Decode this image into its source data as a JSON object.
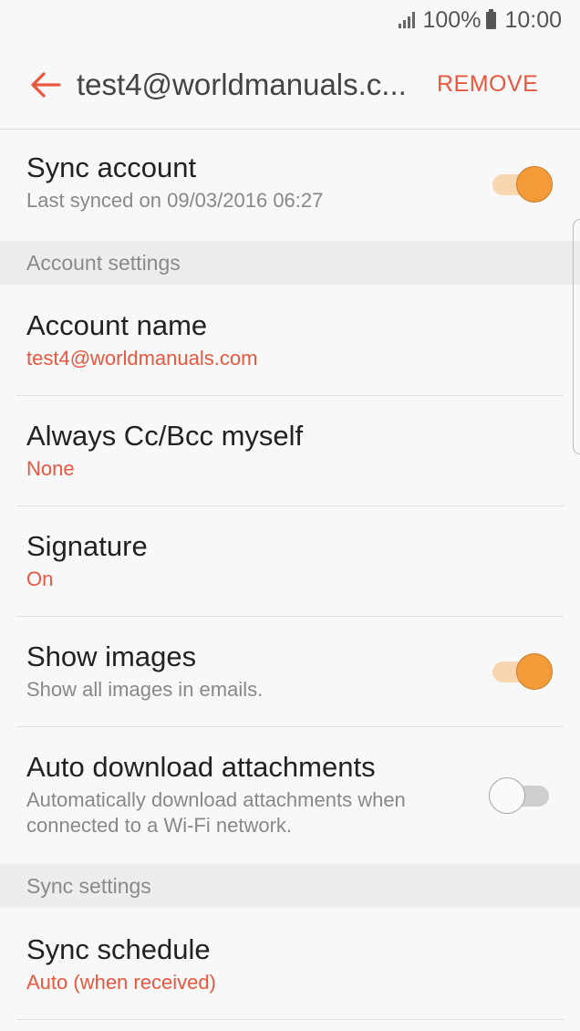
{
  "status_bar": {
    "battery": "100%",
    "time": "10:00"
  },
  "app_bar": {
    "title": "test4@worldmanuals.c...",
    "action": "REMOVE"
  },
  "rows": {
    "sync_account": {
      "title": "Sync account",
      "subtitle": "Last synced on 09/03/2016 06:27",
      "toggle": "on"
    },
    "account_name": {
      "title": "Account name",
      "value": "test4@worldmanuals.com"
    },
    "cc_bcc": {
      "title": "Always Cc/Bcc myself",
      "value": "None"
    },
    "signature": {
      "title": "Signature",
      "value": "On"
    },
    "show_images": {
      "title": "Show images",
      "subtitle": "Show all images in emails.",
      "toggle": "on"
    },
    "auto_download": {
      "title": "Auto download attachments",
      "subtitle_line1": "Automatically download attachments when",
      "subtitle_line2": "connected to a Wi-Fi network.",
      "toggle": "off"
    },
    "sync_schedule": {
      "title": "Sync schedule",
      "value": "Auto (when received)"
    }
  },
  "sections": {
    "account_settings": "Account settings",
    "sync_settings": "Sync settings"
  },
  "colors": {
    "accent": "#e8573e",
    "switch_on": "#f29b38",
    "background": "#f8f8f8"
  },
  "icons": {
    "back": "arrow-left-icon",
    "signal": "signal-icon",
    "battery": "battery-icon"
  }
}
